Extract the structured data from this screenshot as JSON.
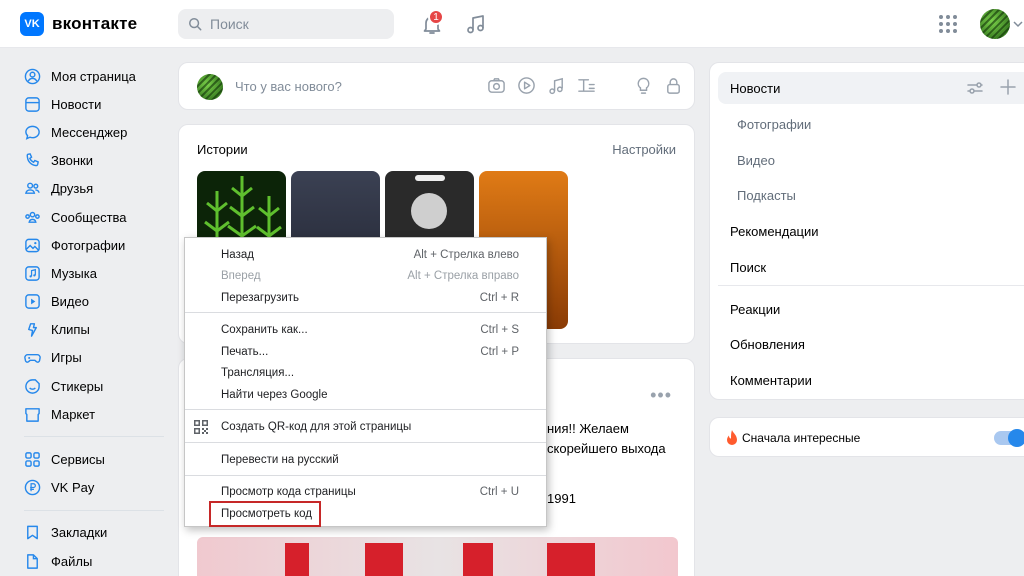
{
  "header": {
    "logo_badge": "VK",
    "logo_text": "вконтакте",
    "search_placeholder": "Поиск",
    "notifications_count": "1"
  },
  "sidebar": {
    "items": [
      {
        "label": "Моя страница",
        "icon": "user-icon"
      },
      {
        "label": "Новости",
        "icon": "newsfeed-icon"
      },
      {
        "label": "Мессенджер",
        "icon": "message-icon"
      },
      {
        "label": "Звонки",
        "icon": "phone-icon"
      },
      {
        "label": "Друзья",
        "icon": "friends-icon"
      },
      {
        "label": "Сообщества",
        "icon": "communities-icon"
      },
      {
        "label": "Фотографии",
        "icon": "photos-icon"
      },
      {
        "label": "Музыка",
        "icon": "music-icon"
      },
      {
        "label": "Видео",
        "icon": "video-icon"
      },
      {
        "label": "Клипы",
        "icon": "clips-icon"
      },
      {
        "label": "Игры",
        "icon": "games-icon"
      },
      {
        "label": "Стикеры",
        "icon": "stickers-icon"
      },
      {
        "label": "Маркет",
        "icon": "market-icon"
      }
    ],
    "items2": [
      {
        "label": "Сервисы",
        "icon": "services-icon"
      },
      {
        "label": "VK Pay",
        "icon": "vkpay-icon"
      }
    ],
    "items3": [
      {
        "label": "Закладки",
        "icon": "bookmark-icon"
      },
      {
        "label": "Файлы",
        "icon": "file-icon"
      }
    ]
  },
  "composer": {
    "placeholder": "Что у вас нового?"
  },
  "stories": {
    "title": "Истории",
    "settings": "Настройки"
  },
  "post": {
    "text": "ния!! Желаем скорейшего выхода",
    "year": "1991"
  },
  "filters": {
    "main": "Новости",
    "sub": [
      "Фотографии",
      "Видео",
      "Подкасты"
    ],
    "group1": [
      "Рекомендации",
      "Поиск"
    ],
    "group2": [
      "Реакции",
      "Обновления",
      "Комментарии"
    ]
  },
  "sort": {
    "label": "Сначала интересные",
    "enabled": true
  },
  "context_menu": {
    "back": {
      "label": "Назад",
      "shortcut": "Alt + Стрелка влево"
    },
    "forward": {
      "label": "Вперед",
      "shortcut": "Alt + Стрелка вправо"
    },
    "reload": {
      "label": "Перезагрузить",
      "shortcut": "Ctrl + R"
    },
    "save_as": {
      "label": "Сохранить как...",
      "shortcut": "Ctrl + S"
    },
    "print": {
      "label": "Печать...",
      "shortcut": "Ctrl + P"
    },
    "cast": {
      "label": "Трансляция..."
    },
    "search_google": {
      "label": "Найти через Google"
    },
    "qr": {
      "label": "Создать QR-код для этой страницы"
    },
    "translate": {
      "label": "Перевести на русский"
    },
    "view_source": {
      "label": "Просмотр кода страницы",
      "shortcut": "Ctrl + U"
    },
    "inspect": {
      "label": "Просмотреть код"
    }
  },
  "colors": {
    "accent": "#0077ff",
    "highlight": "#c62828",
    "badge": "#e64646"
  }
}
